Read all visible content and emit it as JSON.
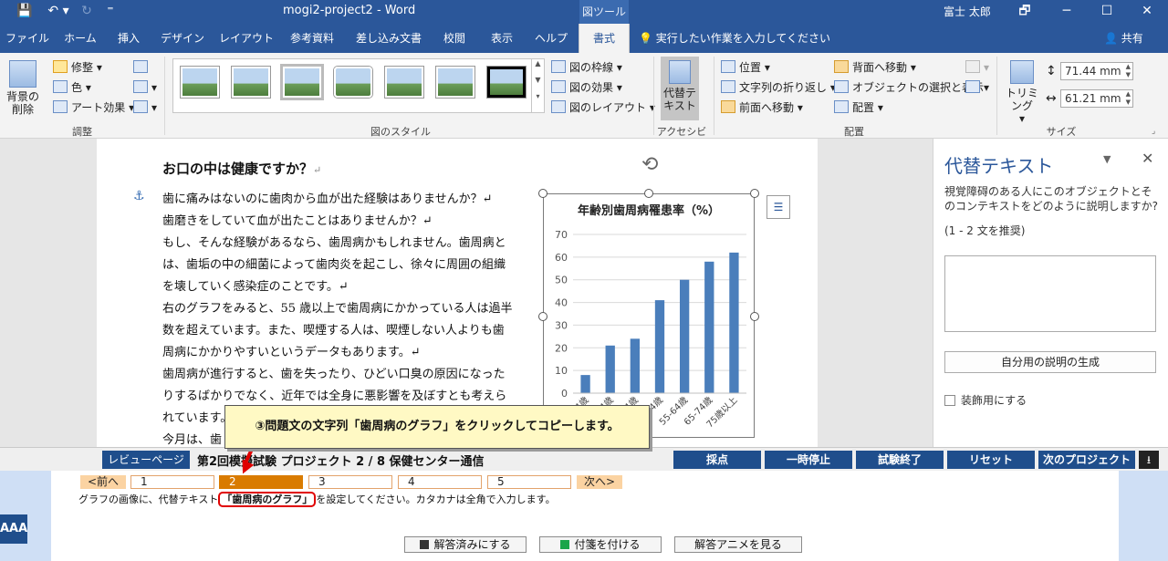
{
  "titlebar": {
    "doc_title": "mogi2-project2  -  Word",
    "context_tag": "図ツール",
    "user": "富士 太郎",
    "qa_save": "💾",
    "qa_undo": "↶ ▾",
    "qa_redo": "↻",
    "qa_more": "⁼",
    "win_restore": "🗗",
    "win_min": "─",
    "win_max": "☐",
    "win_close": "✕"
  },
  "tabs": {
    "items": [
      "ファイル",
      "ホーム",
      "挿入",
      "デザイン",
      "レイアウト",
      "参考資料",
      "差し込み文書",
      "校閲",
      "表示",
      "ヘルプ",
      "書式"
    ],
    "active": "書式",
    "tell_me": "実行したい作業を入力してください",
    "share": "共有"
  },
  "ribbon": {
    "adjust": {
      "remove_bg_line1": "背景の",
      "remove_bg_line2": "削除",
      "corrections": "修整",
      "color": "色",
      "artistic": "アート効果",
      "label": "調整"
    },
    "styles": {
      "border": "図の枠線",
      "effects": "図の効果",
      "layout": "図のレイアウト",
      "label": "図のスタイル"
    },
    "accessibility": {
      "alt_text_line1": "代替テ",
      "alt_text_line2": "キスト",
      "label": "アクセシビリ..."
    },
    "arrange": {
      "position": "位置",
      "wrap": "文字列の折り返し",
      "forward": "前面へ移動",
      "backward": "背面へ移動",
      "selection": "オブジェクトの選択と表示",
      "align": "配置",
      "label": "配置"
    },
    "size": {
      "crop": "トリミング",
      "height": "71.44 mm",
      "width": "61.21 mm",
      "label": "サイズ"
    }
  },
  "document": {
    "heading": "お口の中は健康ですか？",
    "paragraph_mark": "↵",
    "lines": [
      "歯に痛みはないのに歯肉から血が出た経験はありませんか？↵",
      "歯磨きをしていて血が出たことはありませんか？↵",
      "もし、そんな経験があるなら、歯周病かもしれません。歯周病と",
      "は、歯垢の中の細菌によって歯肉炎を起こし、徐々に周囲の組織",
      "を壊していく感染症のことです。↵",
      "右のグラフをみると、55 歳以上で歯周病にかかっている人は過半",
      "数を超えています。また、喫煙する人は、喫煙しない人よりも歯",
      "周病にかかりやすいというデータもあります。↵",
      "歯周病が進行すると、歯を失ったり、ひどい口臭の原因になった",
      "りするばかりでなく、近年では全身に悪影響を及ぼすとも考えら",
      "れています。",
      "今月は、歯"
    ]
  },
  "chart_data": {
    "type": "bar",
    "title": "年齢別歯周病罹患率（%）",
    "categories": [
      "15-24歳",
      "25-34歳",
      "35-44歳",
      "45-54歳",
      "55-64歳",
      "65-74歳",
      "75歳以上"
    ],
    "values": [
      8,
      21,
      24,
      41,
      50,
      58,
      62
    ],
    "ylim": [
      0,
      70
    ],
    "yticks": [
      0,
      10,
      20,
      30,
      40,
      50,
      60,
      70
    ],
    "bar_color": "#4a7ebb",
    "grid": true
  },
  "pane": {
    "title": "代替テキスト",
    "description": "視覚障碍のある人にこのオブジェクトとそのコンテキストをどのように説明しますか?",
    "hint": "(1 - 2 文を推奨)",
    "generate_button": "自分用の説明の生成",
    "decorative": "装飾用にする",
    "text_value": ""
  },
  "callout": {
    "text": "③問題文の文字列「歯周病のグラフ」をクリックしてコピーします。"
  },
  "exam": {
    "review": "レビューページ",
    "title": "第2回模擬試験 プロジェクト 2 / 8 保健センター通信",
    "buttons": [
      "採点",
      "一時停止",
      "試験終了",
      "リセット",
      "次のプロジェクト"
    ],
    "download_icon": "⭳"
  },
  "task": {
    "prev": "<前へ",
    "next": "次へ>",
    "numbers": [
      "1",
      "2",
      "3",
      "4",
      "5"
    ],
    "active_number": "2",
    "instruction_before": "グラフの画像に、代替テキスト",
    "instruction_highlight": "「歯周病のグラフ」",
    "instruction_after": "を設定してください。カタカナは全角で入力します。",
    "font_size_btn": "AAA",
    "bottom_buttons": [
      "解答済みにする",
      "付箋を付ける",
      "解答アニメを見る"
    ]
  }
}
